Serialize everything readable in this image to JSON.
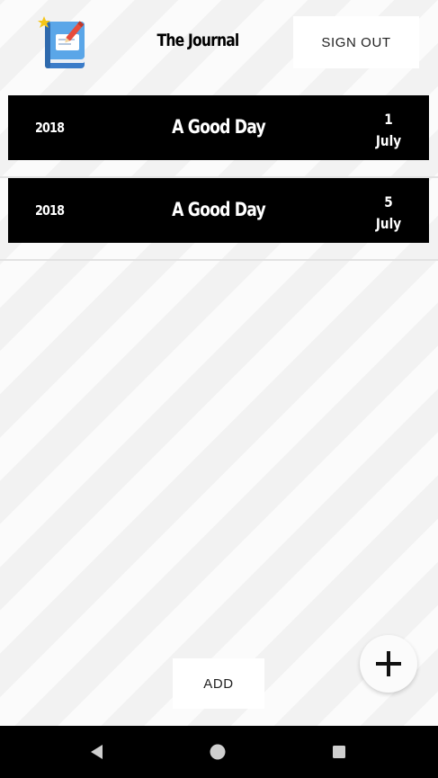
{
  "header": {
    "title": "The Journal",
    "sign_out_label": "SIGN OUT",
    "logo_icon": "journal-book-icon"
  },
  "entries": [
    {
      "year": "2018",
      "title": "A Good Day",
      "day": "1",
      "month": "July"
    },
    {
      "year": "2018",
      "title": "A Good Day",
      "day": "5",
      "month": "July"
    }
  ],
  "actions": {
    "add_label": "ADD",
    "fab_icon": "plus-icon"
  },
  "navigation": {
    "back_icon": "back-triangle-icon",
    "home_icon": "home-circle-icon",
    "recents_icon": "recents-square-icon"
  },
  "colors": {
    "entry_background": "#000000",
    "entry_text": "#ffffff",
    "nav_bar": "#000000",
    "logo_book": "#4a90d9",
    "logo_star": "#f5c518",
    "logo_pen": "#e74c3c"
  }
}
